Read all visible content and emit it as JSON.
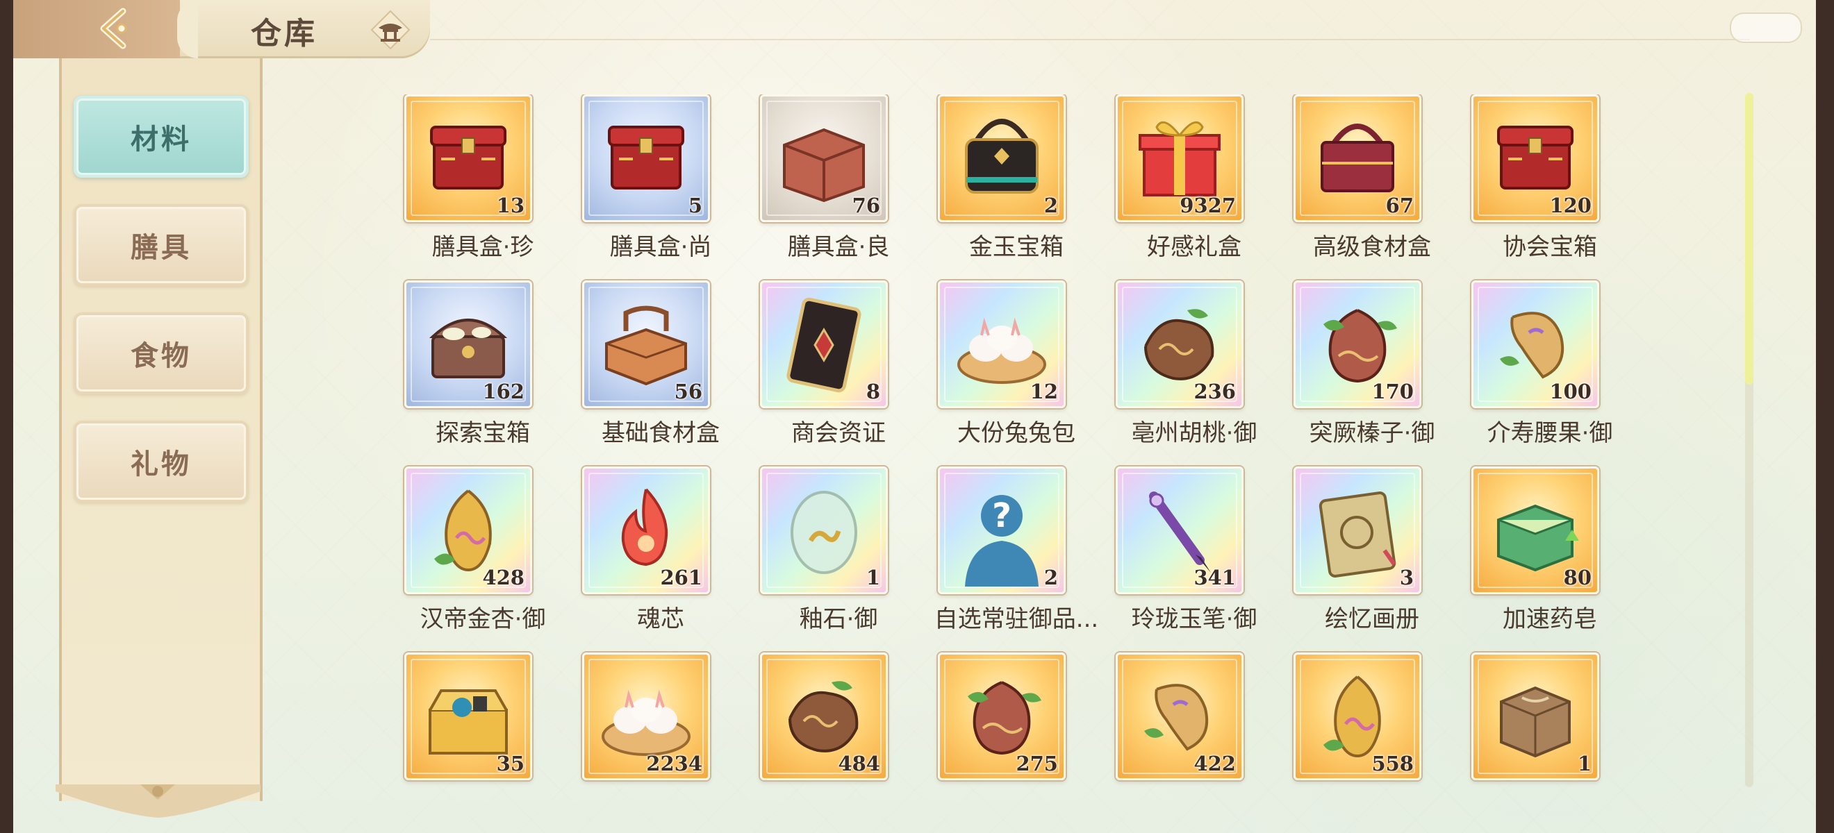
{
  "header": {
    "title": "仓库",
    "back_icon": "chevron-left-icon",
    "home_icon": "pavilion-icon"
  },
  "sidebar": {
    "tabs": [
      {
        "label": "材料",
        "active": true
      },
      {
        "label": "膳具",
        "active": false
      },
      {
        "label": "食物",
        "active": false
      },
      {
        "label": "礼物",
        "active": false
      }
    ]
  },
  "colors": {
    "tab_active": "#a8dcd5",
    "tab_inactive": "#f0e2c6",
    "card_gold": "#ffd275",
    "card_blue": "#c8d8f3",
    "card_rainbow": "#d8fbe0",
    "scroll_thumb": "#eef19a"
  },
  "items": [
    {
      "name": "膳具盒·珍",
      "qty": "13",
      "rarity": "gold",
      "icon": "red-chest-icon"
    },
    {
      "name": "膳具盒·尚",
      "qty": "5",
      "rarity": "blue",
      "icon": "red-chest-icon"
    },
    {
      "name": "膳具盒·良",
      "qty": "76",
      "rarity": "gray",
      "icon": "brown-box-icon"
    },
    {
      "name": "金玉宝箱",
      "qty": "2",
      "rarity": "gold",
      "icon": "black-basket-icon"
    },
    {
      "name": "好感礼盒",
      "qty": "9327",
      "rarity": "gold",
      "icon": "gift-box-icon"
    },
    {
      "name": "高级食材盒",
      "qty": "67",
      "rarity": "gold",
      "icon": "food-basket-icon"
    },
    {
      "name": "协会宝箱",
      "qty": "120",
      "rarity": "gold",
      "icon": "red-chest-icon"
    },
    {
      "name": "探索宝箱",
      "qty": "162",
      "rarity": "blue",
      "icon": "treasure-chest-icon"
    },
    {
      "name": "基础食材盒",
      "qty": "56",
      "rarity": "blue",
      "icon": "wooden-basket-icon"
    },
    {
      "name": "商会资证",
      "qty": "8",
      "rarity": "rainbow",
      "icon": "card-icon"
    },
    {
      "name": "大份兔兔包",
      "qty": "12",
      "rarity": "rainbow",
      "icon": "steamed-bun-icon"
    },
    {
      "name": "亳州胡桃·御",
      "qty": "236",
      "rarity": "rainbow",
      "icon": "walnut-icon"
    },
    {
      "name": "突厥榛子·御",
      "qty": "170",
      "rarity": "rainbow",
      "icon": "hazelnut-icon"
    },
    {
      "name": "介寿腰果·御",
      "qty": "100",
      "rarity": "rainbow",
      "icon": "cashew-icon"
    },
    {
      "name": "汉帝金杏·御",
      "qty": "428",
      "rarity": "rainbow",
      "icon": "almond-icon"
    },
    {
      "name": "魂芯",
      "qty": "261",
      "rarity": "rainbow",
      "icon": "flame-icon"
    },
    {
      "name": "釉石·御",
      "qty": "1",
      "rarity": "rainbow",
      "icon": "glaze-stone-icon"
    },
    {
      "name": "自选常驻御品...",
      "qty": "2",
      "rarity": "rainbow",
      "icon": "question-mark-icon"
    },
    {
      "name": "玲珑玉笔·御",
      "qty": "341",
      "rarity": "rainbow",
      "icon": "brush-pen-icon"
    },
    {
      "name": "绘忆画册",
      "qty": "3",
      "rarity": "rainbow",
      "icon": "picture-book-icon"
    },
    {
      "name": "加速药皂",
      "qty": "80",
      "rarity": "gold",
      "icon": "soap-icon"
    },
    {
      "name": "",
      "qty": "35",
      "rarity": "gold",
      "icon": "toolbox-icon"
    },
    {
      "name": "",
      "qty": "2234",
      "rarity": "gold",
      "icon": "steamed-bun-icon"
    },
    {
      "name": "",
      "qty": "484",
      "rarity": "gold",
      "icon": "walnut-icon"
    },
    {
      "name": "",
      "qty": "275",
      "rarity": "gold",
      "icon": "hazelnut-icon"
    },
    {
      "name": "",
      "qty": "422",
      "rarity": "gold",
      "icon": "cashew-icon"
    },
    {
      "name": "",
      "qty": "558",
      "rarity": "gold",
      "icon": "almond-icon"
    },
    {
      "name": "",
      "qty": "1",
      "rarity": "gold",
      "icon": "parcel-icon"
    }
  ]
}
